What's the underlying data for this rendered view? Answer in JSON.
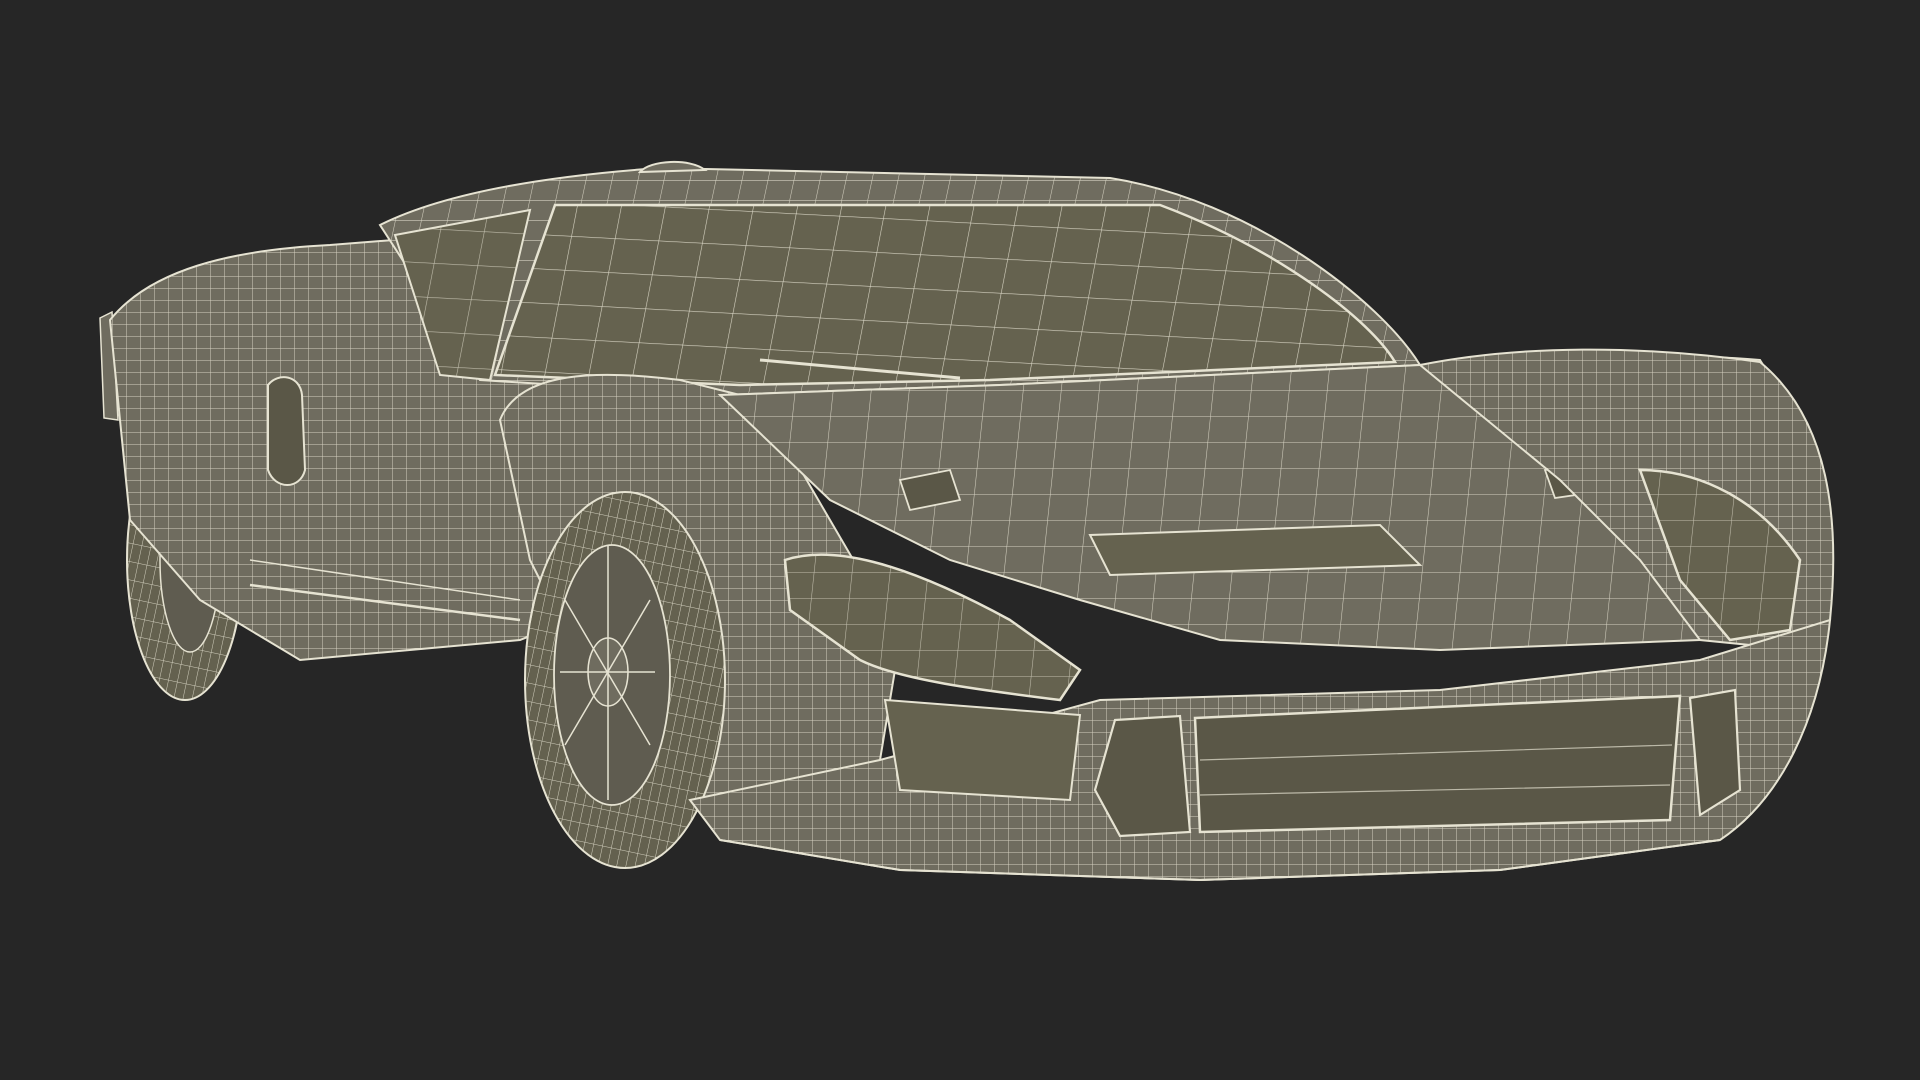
{
  "scene": {
    "subject": "sports-car-wireframe-render",
    "background_color": "#262626",
    "body_fill_color": "#6f6c5f",
    "body_shade_color": "#5f5c50",
    "glass_fill_color": "#65624f",
    "wire_color": "#e6e3d2",
    "tire_fill_color": "#64614f",
    "grille_fill_color": "#5a5747"
  }
}
